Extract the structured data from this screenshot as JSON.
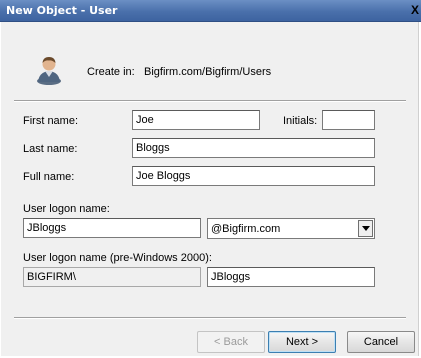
{
  "window": {
    "title": "New Object - User",
    "close_label": "X"
  },
  "header": {
    "icon": "user-icon",
    "create_in_label": "Create in:",
    "create_in_path": "Bigfirm.com/Bigfirm/Users"
  },
  "form": {
    "first_name": {
      "label": "First name:",
      "value": "Joe"
    },
    "initials": {
      "label": "Initials:",
      "value": ""
    },
    "last_name": {
      "label": "Last name:",
      "value": "Bloggs"
    },
    "full_name": {
      "label": "Full name:",
      "value": "Joe Bloggs"
    },
    "logon_name": {
      "label": "User logon name:",
      "value": "JBloggs",
      "domain_selected": "@Bigfirm.com"
    },
    "pre2000": {
      "label": "User logon name (pre-Windows 2000):",
      "domain_prefix": "BIGFIRM\\",
      "value": "JBloggs"
    }
  },
  "buttons": {
    "back": "< Back",
    "next": "Next >",
    "cancel": "Cancel"
  }
}
